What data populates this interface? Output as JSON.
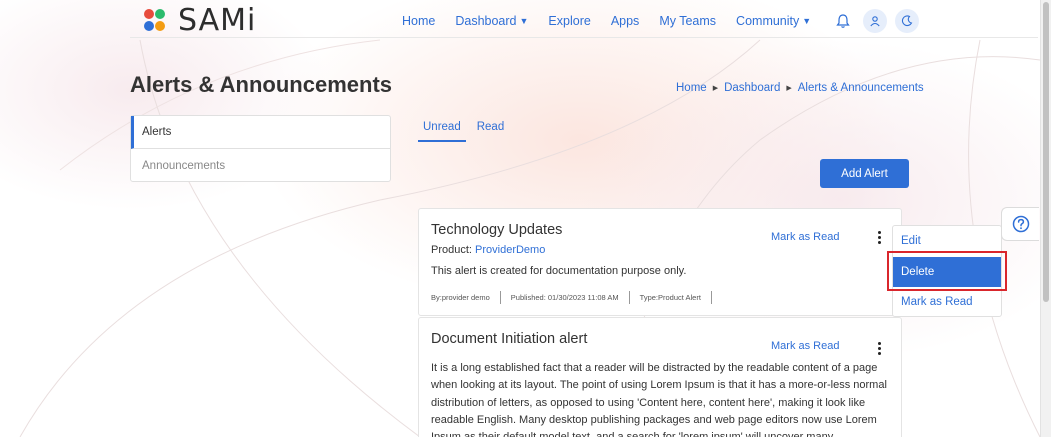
{
  "brand": {
    "name": "SAMi",
    "colors": {
      "blue": "#2f6fd6",
      "green": "#2bbb6c",
      "orange": "#f39c12",
      "red": "#e74c3c",
      "highlight": "#d9262c"
    }
  },
  "nav": {
    "items": [
      {
        "label": "Home",
        "dropdown": false
      },
      {
        "label": "Dashboard",
        "dropdown": true
      },
      {
        "label": "Explore",
        "dropdown": false
      },
      {
        "label": "Apps",
        "dropdown": false
      },
      {
        "label": "My Teams",
        "dropdown": false
      },
      {
        "label": "Community",
        "dropdown": true
      }
    ],
    "icons": [
      "bell-icon",
      "user-icon",
      "moon-icon"
    ]
  },
  "page": {
    "title": "Alerts & Announcements"
  },
  "breadcrumb": [
    "Home",
    "Dashboard",
    "Alerts & Announcements"
  ],
  "sidebar": {
    "items": [
      {
        "label": "Alerts",
        "active": true
      },
      {
        "label": "Announcements",
        "active": false
      }
    ]
  },
  "tabs": [
    {
      "label": "Unread",
      "active": true
    },
    {
      "label": "Read",
      "active": false
    }
  ],
  "actions": {
    "add_alert": "Add Alert"
  },
  "alerts": [
    {
      "title": "Technology Updates",
      "product_label": "Product:",
      "product_value": "ProviderDemo",
      "description": "This alert is created for documentation purpose only.",
      "by": "By:provider demo",
      "published": "Published: 01/30/2023 11:08 AM",
      "type": "Type:Product Alert",
      "mark_read": "Mark as Read"
    },
    {
      "title": "Document Initiation alert",
      "mark_read": "Mark as Read",
      "body": "It is a long established fact that a reader will be distracted by the readable content of a page when looking at its layout. The point of using Lorem Ipsum is that it has a more-or-less normal distribution of letters, as opposed to using 'Content here, content here', making it look like readable English. Many desktop publishing packages and web page editors now use Lorem Ipsum as their default model text, and a search for 'lorem ipsum' will uncover many"
    }
  ],
  "context_menu": {
    "items": [
      "Edit",
      "Delete",
      "Mark as Read"
    ],
    "selected": "Delete"
  },
  "help": {
    "icon": "question-circle-icon"
  }
}
